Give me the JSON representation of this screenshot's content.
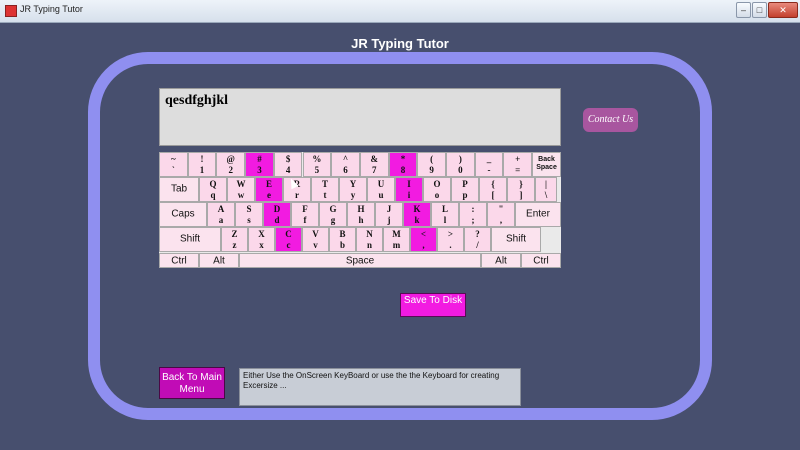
{
  "window": {
    "title": "JR Typing Tutor",
    "min": "–",
    "max": "□",
    "close": "✕"
  },
  "app_title": "JR Typing Tutor",
  "practice_text": "qesdfghjkl",
  "contact_label": "Contact Us",
  "save_label": "Save To Disk",
  "back_label": "Back To Main Menu",
  "hint_text": "Either Use the OnScreen KeyBoard or use the the Keyboard for creating Excersize ...",
  "keyboard": {
    "rows": [
      [
        {
          "top": "~",
          "bottom": "`"
        },
        {
          "top": "!",
          "bottom": "1"
        },
        {
          "top": "@",
          "bottom": "2"
        },
        {
          "top": "#",
          "bottom": "3",
          "hl": true
        },
        {
          "top": "$",
          "bottom": "4"
        },
        {
          "top": "%",
          "bottom": "5"
        },
        {
          "top": "^",
          "bottom": "6"
        },
        {
          "top": "&",
          "bottom": "7"
        },
        {
          "top": "*",
          "bottom": "8",
          "hl": true
        },
        {
          "top": "(",
          "bottom": "9"
        },
        {
          "top": ")",
          "bottom": "0"
        },
        {
          "top": "_",
          "bottom": "-"
        },
        {
          "top": "+",
          "bottom": "="
        },
        {
          "label": "Back Space",
          "small": true
        }
      ],
      [
        {
          "label": "Tab"
        },
        {
          "top": "Q",
          "bottom": "q"
        },
        {
          "top": "W",
          "bottom": "w"
        },
        {
          "top": "E",
          "bottom": "e",
          "hl": true
        },
        {
          "top": "R",
          "bottom": "r"
        },
        {
          "top": "T",
          "bottom": "t"
        },
        {
          "top": "Y",
          "bottom": "y"
        },
        {
          "top": "U",
          "bottom": "u"
        },
        {
          "top": "I",
          "bottom": "i",
          "hl": true
        },
        {
          "top": "O",
          "bottom": "o"
        },
        {
          "top": "P",
          "bottom": "p"
        },
        {
          "top": "{",
          "bottom": "["
        },
        {
          "top": "}",
          "bottom": "]"
        },
        {
          "top": "|",
          "bottom": "\\"
        }
      ],
      [
        {
          "label": "Caps"
        },
        {
          "top": "A",
          "bottom": "a"
        },
        {
          "top": "S",
          "bottom": "s"
        },
        {
          "top": "D",
          "bottom": "d",
          "hl": true
        },
        {
          "top": "F",
          "bottom": "f"
        },
        {
          "top": "G",
          "bottom": "g"
        },
        {
          "top": "H",
          "bottom": "h"
        },
        {
          "top": "J",
          "bottom": "j"
        },
        {
          "top": "K",
          "bottom": "k",
          "hl": true
        },
        {
          "top": "L",
          "bottom": "l"
        },
        {
          "top": ":",
          "bottom": ";"
        },
        {
          "top": "\"",
          "bottom": ","
        },
        {
          "label": "Enter"
        }
      ],
      [
        {
          "label": "Shift"
        },
        {
          "top": "Z",
          "bottom": "z"
        },
        {
          "top": "X",
          "bottom": "x"
        },
        {
          "top": "C",
          "bottom": "c",
          "hl": true
        },
        {
          "top": "V",
          "bottom": "v"
        },
        {
          "top": "B",
          "bottom": "b"
        },
        {
          "top": "N",
          "bottom": "n"
        },
        {
          "top": "M",
          "bottom": "m"
        },
        {
          "top": "<",
          "bottom": ",",
          "hl": true
        },
        {
          "top": ">",
          "bottom": "."
        },
        {
          "top": "?",
          "bottom": "/"
        },
        {
          "label": "Shift"
        }
      ],
      [
        {
          "label": "Ctrl"
        },
        {
          "label": "Alt"
        },
        {
          "label": "Space"
        },
        {
          "label": "Alt"
        },
        {
          "label": "Ctrl"
        }
      ]
    ]
  },
  "colors": {
    "background": "#474f6e",
    "frame": "#8f8ff0",
    "key": "#fbd8ea",
    "key_highlight": "#f21be1",
    "button": "#c10cb6"
  }
}
